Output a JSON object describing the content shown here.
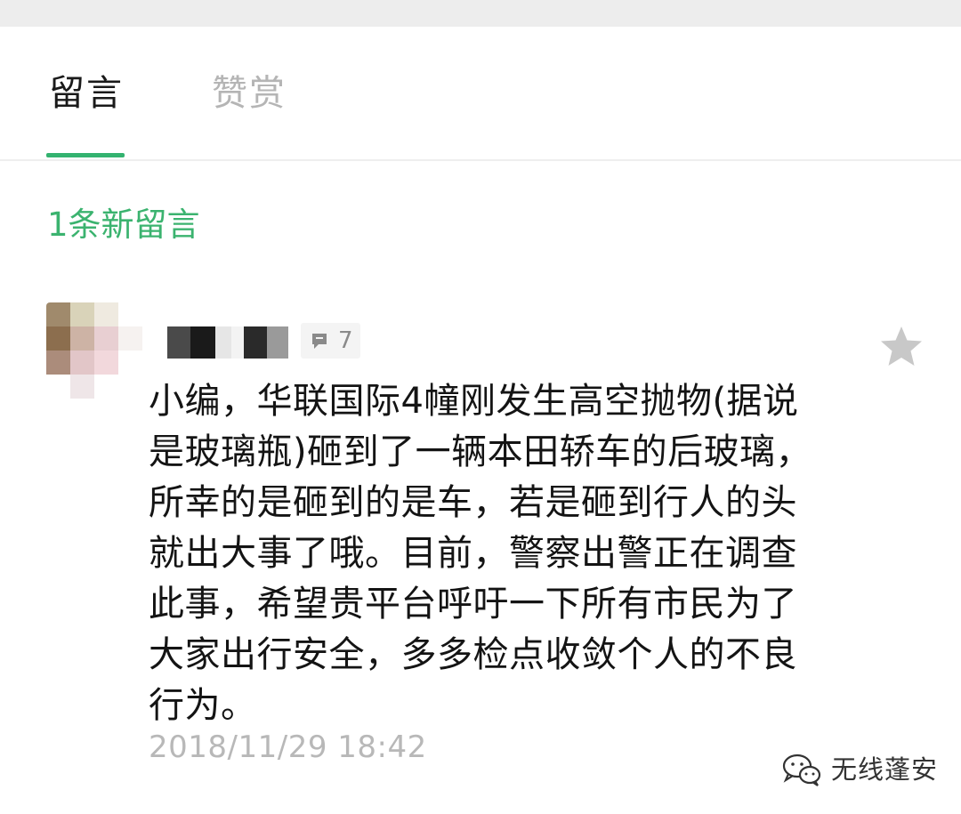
{
  "tabs": {
    "comments_label": "留言",
    "rewards_label": "赞赏"
  },
  "new_comments": "1条新留言",
  "comment": {
    "like_count": "7",
    "text": "小编，华联国际4幢刚发生高空抛物(据说\n是玻璃瓶)砸到了一辆本田轿车的后玻璃，\n所幸的是砸到的是车，若是砸到行人的头\n就出大事了哦。目前，警察出警正在调查\n此事，希望贵平台呼吁一下所有市民为了\n大家出行安全，多多检点收敛个人的不良\n行为。",
    "timestamp": "2018/11/29 18:42"
  },
  "watermark": {
    "text": "无线蓬安"
  },
  "colors": {
    "accent": "#33b26f",
    "inactive_tab": "#b5b5b5",
    "timestamp": "#b8b8b8"
  },
  "icons": {
    "like": "thumb-icon",
    "favorite": "star-icon",
    "watermark_logo": "wechat-logo-icon"
  }
}
